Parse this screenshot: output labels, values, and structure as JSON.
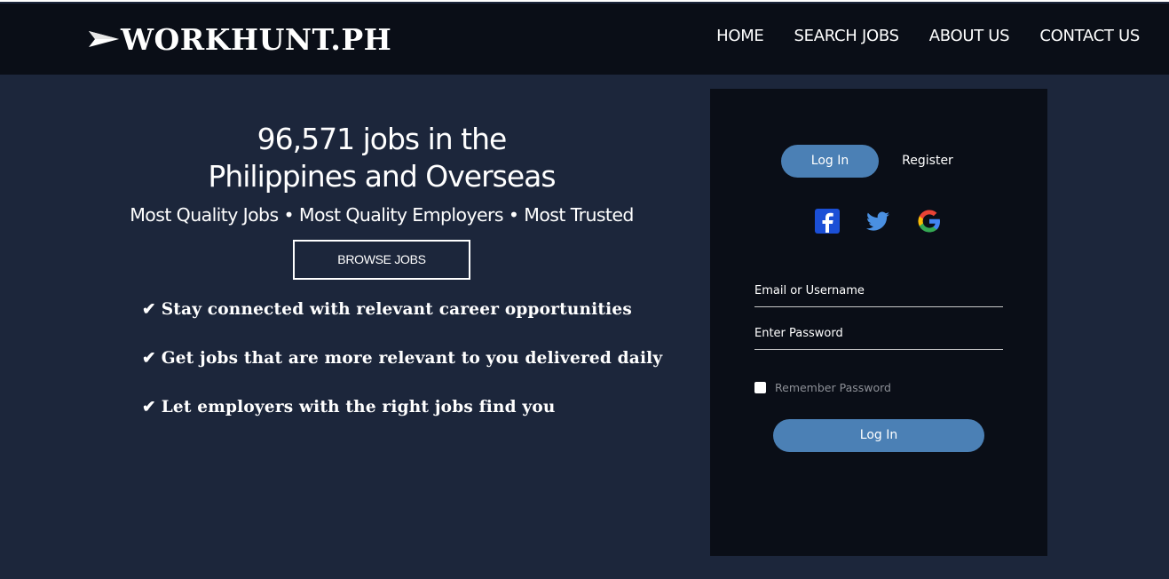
{
  "header": {
    "logo_text": "WORKHUNT.PH",
    "nav": [
      {
        "label": "HOME"
      },
      {
        "label": "SEARCH JOBS"
      },
      {
        "label": "ABOUT US"
      },
      {
        "label": "CONTACT US"
      }
    ]
  },
  "hero": {
    "title_line1": "96,571 jobs in the",
    "title_line2": "Philippines and Overseas",
    "subtitle": "Most Quality Jobs • Most Quality Employers • Most Trusted",
    "browse_label": "BROWSE JOBS"
  },
  "benefits": {
    "check": "✔",
    "items": [
      "Stay connected with relevant career opportunities",
      "Get jobs that are more relevant to you delivered daily",
      "Let employers with the right jobs find you"
    ]
  },
  "auth": {
    "tab_login": "Log In",
    "tab_register": "Register",
    "social_icons": [
      "facebook-icon",
      "twitter-icon",
      "google-icon"
    ],
    "email_placeholder": "Email or Username",
    "password_placeholder": "Enter Password",
    "remember_label": "Remember Password",
    "remember_checked": false,
    "submit_label": "Log In"
  },
  "colors": {
    "background": "#1c263b",
    "navbar": "#0a0e17",
    "panel": "#0a0e17",
    "accent": "#4b80b5",
    "facebook": "#1b4fd6",
    "twitter": "#4a90e2"
  }
}
